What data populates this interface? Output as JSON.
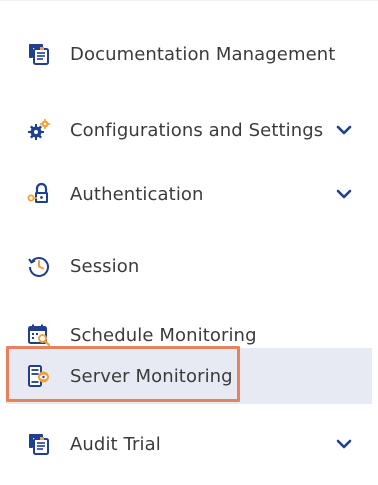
{
  "menu": {
    "items": [
      {
        "label": "Documentation Management",
        "icon": "document-stack-icon",
        "has_chevron": false
      },
      {
        "label": "Configurations and Settings",
        "icon": "gears-icon",
        "has_chevron": true
      },
      {
        "label": "Authentication",
        "icon": "key-lock-icon",
        "has_chevron": true
      },
      {
        "label": "Session",
        "icon": "history-clock-icon",
        "has_chevron": false
      },
      {
        "label": "Schedule Monitoring",
        "icon": "calendar-search-icon",
        "has_chevron": false
      },
      {
        "label": "Server Monitoring",
        "icon": "server-monitor-icon",
        "has_chevron": false,
        "selected": true
      },
      {
        "label": "Audit Trial",
        "icon": "document-stack-icon",
        "has_chevron": true
      }
    ]
  },
  "colors": {
    "accent_blue": "#1f3f8f",
    "highlight_bg": "#e7eaf3",
    "highlight_border": "#e8825e",
    "icon_orange": "#f2a13a"
  }
}
